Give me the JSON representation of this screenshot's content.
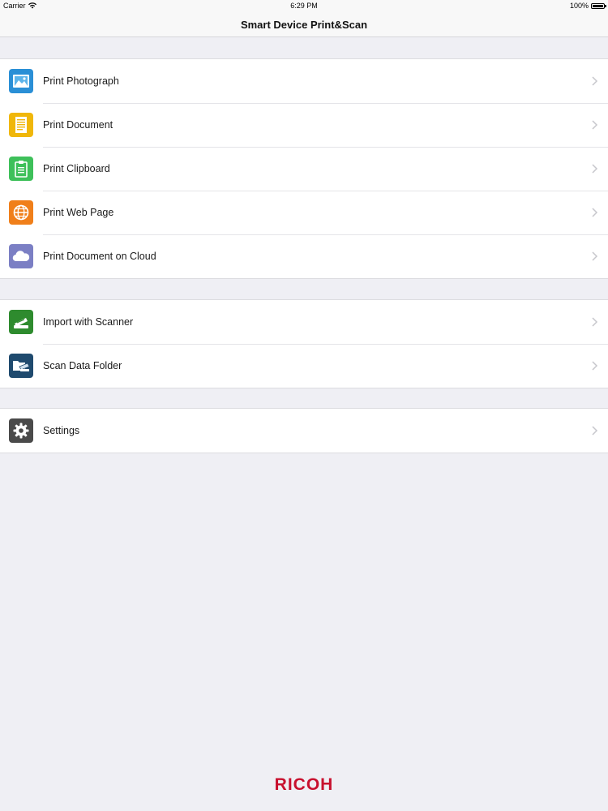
{
  "status_bar": {
    "carrier": "Carrier",
    "time": "6:29 PM",
    "battery": "100%",
    "battery_level": 1.0
  },
  "nav": {
    "title": "Smart Device Print&Scan"
  },
  "print_group": [
    {
      "label": "Print Photograph",
      "icon": "photo-icon",
      "color": "#2a8fd6"
    },
    {
      "label": "Print Document",
      "icon": "document-icon",
      "color": "#f0b70a"
    },
    {
      "label": "Print Clipboard",
      "icon": "clipboard-icon",
      "color": "#3ec05a"
    },
    {
      "label": "Print Web Page",
      "icon": "globe-icon",
      "color": "#f07f1a"
    },
    {
      "label": "Print Document on Cloud",
      "icon": "cloud-icon",
      "color": "#7b7fc4"
    }
  ],
  "scan_group": [
    {
      "label": "Import with Scanner",
      "icon": "scanner-icon",
      "color": "#2e8b2e"
    },
    {
      "label": "Scan Data Folder",
      "icon": "folder-icon",
      "color": "#1f4a6e"
    }
  ],
  "settings_group": [
    {
      "label": "Settings",
      "icon": "gear-icon",
      "color": "#4a4a4a"
    }
  ],
  "footer": {
    "logo_text": "RICOH",
    "logo_color": "#c8102e"
  },
  "colors": {
    "background": "#efeff4",
    "chevron": "#c7c7cc"
  }
}
